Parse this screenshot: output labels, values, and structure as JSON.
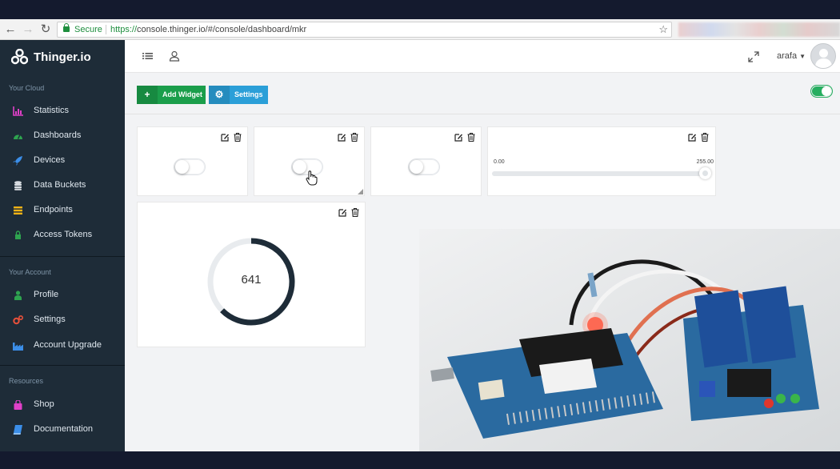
{
  "browser": {
    "secure_label": "Secure",
    "url_scheme": "https://",
    "url_rest": "console.thinger.io/#/console/dashboard/mkr",
    "icons": {
      "back": "back-arrow-icon",
      "forward": "forward-arrow-icon",
      "reload": "reload-icon",
      "lock": "lock-icon",
      "bookmark": "star-icon"
    }
  },
  "brand": {
    "name": "Thinger.io",
    "icon": "thinger-logo-icon"
  },
  "sidebar": {
    "sections": [
      {
        "title": "Your Cloud",
        "items": [
          {
            "label": "Statistics",
            "icon": "chart-icon",
            "color": "#e040c8"
          },
          {
            "label": "Dashboards",
            "icon": "dashboard-icon",
            "color": "#2ea44f"
          },
          {
            "label": "Devices",
            "icon": "rocket-icon",
            "color": "#3b8ee8"
          },
          {
            "label": "Data Buckets",
            "icon": "database-icon",
            "color": "#d8dde2"
          },
          {
            "label": "Endpoints",
            "icon": "endpoints-icon",
            "color": "#f2b316"
          },
          {
            "label": "Access Tokens",
            "icon": "lock-icon",
            "color": "#2ea44f"
          }
        ]
      },
      {
        "title": "Your Account",
        "items": [
          {
            "label": "Profile",
            "icon": "user-icon",
            "color": "#2ea44f"
          },
          {
            "label": "Settings",
            "icon": "cogs-icon",
            "color": "#e8503a"
          },
          {
            "label": "Account Upgrade",
            "icon": "industry-icon",
            "color": "#3b8ee8"
          }
        ]
      },
      {
        "title": "Resources",
        "items": [
          {
            "label": "Shop",
            "icon": "shopping-bag-icon",
            "color": "#e040c8"
          },
          {
            "label": "Documentation",
            "icon": "book-icon",
            "color": "#3b8ee8"
          }
        ]
      }
    ]
  },
  "header": {
    "user_name": "arafa",
    "icons": {
      "menu": "list-menu-icon",
      "user": "user-outline-icon",
      "fullscreen": "expand-icon",
      "caret": "caret-down-icon",
      "avatar": "avatar-icon"
    }
  },
  "toolbar": {
    "add_widget_label": "Add Widget",
    "settings_label": "Settings",
    "master_toggle_on": true
  },
  "widgets": {
    "toggles": [
      {
        "on": false
      },
      {
        "on": false
      },
      {
        "on": false
      }
    ],
    "slider": {
      "min": "0.00",
      "max": "255.00",
      "value": 255
    },
    "gauge": {
      "value": "641",
      "max": 1023
    }
  },
  "colors": {
    "accent_green": "#1b9e4b",
    "accent_blue": "#2b9fd8",
    "sidebar_bg": "#1e2c38",
    "gauge_arc": "#1e2c38"
  }
}
